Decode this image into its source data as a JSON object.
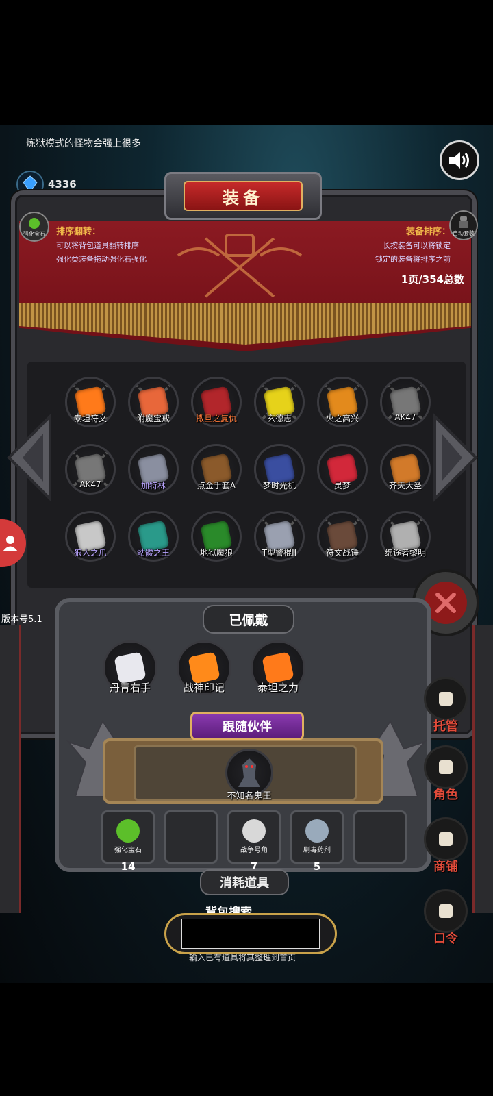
{
  "notice": "炼狱模式的怪物会强上很多",
  "gems": {
    "count": "4336",
    "label": "宝石"
  },
  "panel": {
    "title": "装备",
    "strengthen_gem_label": "强化宝石",
    "auto_suit_label": "自动套装",
    "tip_left": {
      "head": "排序翻转：",
      "line1": "可以将背包道具翻转排序",
      "line2": "强化类装备拖动强化石强化"
    },
    "tip_right": {
      "head": "装备排序：",
      "line1": "长按装备可以将锁定",
      "line2": "锁定的装备将排序之前"
    },
    "page_info": "1页/354总数"
  },
  "equipment_grid": [
    {
      "label": "泰坦符文",
      "icon": "rune-stone-icon",
      "color": "#ff7a1a",
      "locked": true
    },
    {
      "label": "附魔宝戒",
      "icon": "enchanted-ring-icon",
      "color": "#e8673a",
      "locked": true
    },
    {
      "label": "撒旦之复仇",
      "icon": "satan-wings-icon",
      "color": "#b2262b",
      "locked": false,
      "label_color": "#ff7a3a"
    },
    {
      "label": "玄德志",
      "icon": "gold-scroll-icon",
      "color": "#e6d21a",
      "locked": true
    },
    {
      "label": "火之高兴",
      "icon": "flame-sword-icon",
      "color": "#e38a1c",
      "locked": true
    },
    {
      "label": "AK47",
      "icon": "ak47-icon",
      "color": "#777",
      "locked": true
    },
    {
      "label": "AK47",
      "icon": "ak47-icon",
      "color": "#777",
      "locked": true
    },
    {
      "label": "加特林",
      "icon": "gatling-icon",
      "color": "#8a8fa0",
      "locked": false,
      "label_color": "#b9a4ff"
    },
    {
      "label": "点金手套A",
      "icon": "gauntlet-icon",
      "color": "#8b5a2b",
      "locked": false
    },
    {
      "label": "梦时光机",
      "icon": "time-machine-icon",
      "color": "#3a4ea0",
      "locked": false
    },
    {
      "label": "灵梦",
      "icon": "reimu-icon",
      "color": "#d2283a",
      "locked": false
    },
    {
      "label": "齐天大圣",
      "icon": "monkey-king-icon",
      "color": "#d27a2a",
      "locked": false
    },
    {
      "label": "狼人之爪",
      "icon": "werewolf-claw-icon",
      "color": "#c8c8c8",
      "locked": false,
      "label_color": "#b9a4ff"
    },
    {
      "label": "骷髅之王",
      "icon": "skeleton-king-icon",
      "color": "#2a9a8a",
      "locked": false,
      "label_color": "#b9a4ff"
    },
    {
      "label": "地狱魔狼",
      "icon": "hell-wolf-icon",
      "color": "#2a8a2a",
      "locked": false
    },
    {
      "label": "T型警棍II",
      "icon": "baton-icon",
      "color": "#9aa0b0",
      "locked": true
    },
    {
      "label": "符文战锤",
      "icon": "war-hammer-icon",
      "color": "#6a4a3a",
      "locked": true
    },
    {
      "label": "绵途者黎明",
      "icon": "greatsword-icon",
      "color": "#b0b0b0",
      "locked": true
    }
  ],
  "version": "版本号5.1",
  "worn": {
    "title": "已佩戴",
    "items": [
      {
        "label": "丹青右手",
        "icon": "white-glove-icon",
        "color": "#e8e8ee"
      },
      {
        "label": "战神印记",
        "icon": "war-mark-icon",
        "color": "#ff8a1a"
      },
      {
        "label": "泰坦之力",
        "icon": "titan-rune-icon",
        "color": "#ff7a1a"
      }
    ]
  },
  "companion": {
    "title": "跟随伙伴",
    "label": "不知名鬼王",
    "icon": "ghost-king-icon"
  },
  "consumables": {
    "title": "消耗道具",
    "items": [
      {
        "label": "强化宝石",
        "count": "14",
        "icon": "green-gem-icon",
        "color": "#5cbf2a"
      },
      {
        "label": "",
        "count": "",
        "icon": "",
        "color": ""
      },
      {
        "label": "战争号角",
        "count": "7",
        "icon": "war-horn-icon",
        "color": "#d8d8d8"
      },
      {
        "label": "剧毒药剂",
        "count": "5",
        "icon": "poison-potion-icon",
        "color": "#9ab"
      },
      {
        "label": "",
        "count": "",
        "icon": "",
        "color": ""
      }
    ]
  },
  "search": {
    "label": "背包搜索",
    "value": "",
    "hint": "输入已有道具将其整理到首页"
  },
  "right_menu": [
    {
      "label": "托管",
      "icon": "dice-icon"
    },
    {
      "label": "角色",
      "icon": "hooded-character-icon"
    },
    {
      "label": "商铺",
      "icon": "shop-icon"
    },
    {
      "label": "口令",
      "icon": "scroll-icon"
    }
  ]
}
